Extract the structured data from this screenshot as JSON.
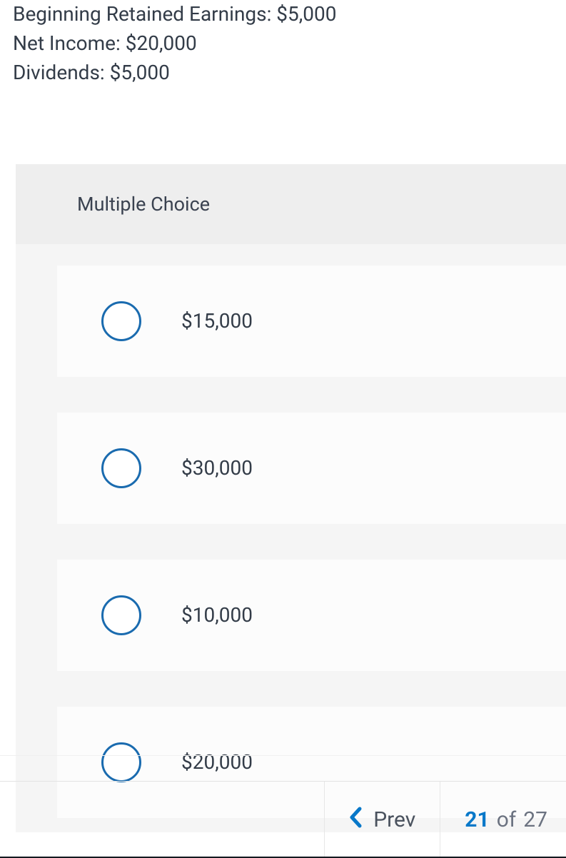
{
  "question": {
    "lines": [
      "Beginning Retained Earnings: $5,000",
      "Net Income: $20,000",
      "Dividends: $5,000"
    ]
  },
  "mc": {
    "header": "Multiple Choice",
    "options": [
      {
        "label": "$15,000"
      },
      {
        "label": "$30,000"
      },
      {
        "label": "$10,000"
      },
      {
        "label": "$20,000"
      }
    ]
  },
  "nav": {
    "prev_label": "Prev",
    "current_page": "21",
    "of_label": "of",
    "total_pages": "27"
  }
}
